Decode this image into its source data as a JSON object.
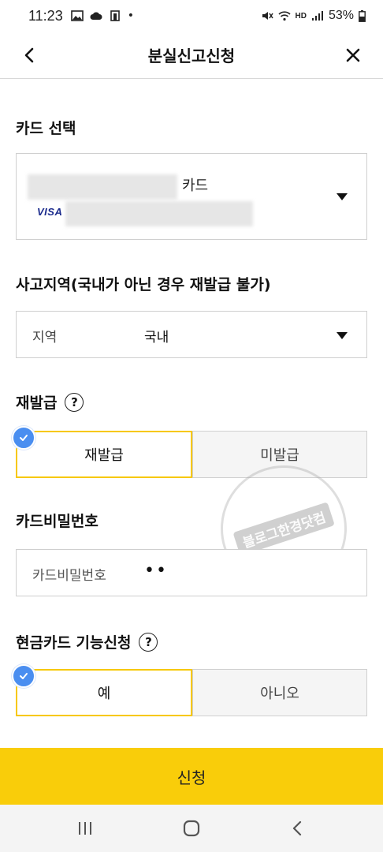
{
  "status_bar": {
    "time": "11:23",
    "battery": "53%",
    "dot": "•",
    "net_label": "HD",
    "icons": [
      "image-icon",
      "cloud-icon",
      "cast-icon",
      "mute-icon",
      "wifi-icon",
      "signal-icon",
      "battery-icon"
    ]
  },
  "header": {
    "title": "분실신고신청",
    "back_icon": "chevron-left-icon",
    "close_icon": "close-icon"
  },
  "card_select": {
    "label": "카드 선택",
    "card_suffix": "카드",
    "card_brand": "VISA"
  },
  "region": {
    "label": "사고지역(국내가 아닌 경우 재발급 불가)",
    "field_label": "지역",
    "value": "국내"
  },
  "reissue": {
    "label": "재발급",
    "help": "?",
    "options": [
      "재발급",
      "미발급"
    ],
    "selected": 0
  },
  "password": {
    "label": "카드비밀번호",
    "placeholder": "카드비밀번호",
    "value": "••"
  },
  "cash_card": {
    "label": "현금카드 기능신청",
    "help": "?",
    "options": [
      "예",
      "아니오"
    ],
    "selected": 0
  },
  "watermark": {
    "text": "블로그한경닷컴"
  },
  "submit": {
    "label": "신청"
  },
  "colors": {
    "accent": "#f9cd0a",
    "selected_border": "#f7c800",
    "check_badge": "#4a8ef0"
  }
}
